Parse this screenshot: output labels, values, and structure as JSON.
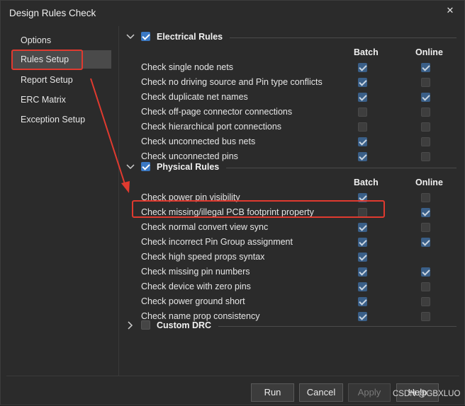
{
  "window": {
    "title": "Design Rules Check",
    "close_glyph": "✕"
  },
  "sidebar": {
    "items": [
      {
        "label": "Options",
        "active": false
      },
      {
        "label": "Rules Setup",
        "active": true
      },
      {
        "label": "Report Setup",
        "active": false
      },
      {
        "label": "ERC Matrix",
        "active": false
      },
      {
        "label": "Exception Setup",
        "active": false
      }
    ]
  },
  "columns": {
    "batch": "Batch",
    "online": "Online"
  },
  "sections": [
    {
      "title": "Electrical Rules",
      "expanded": true,
      "checked": true,
      "rules": [
        {
          "label": "Check single node nets",
          "batch": true,
          "online": true
        },
        {
          "label": "Check no driving source and Pin type conflicts",
          "batch": true,
          "online": false
        },
        {
          "label": "Check duplicate net names",
          "batch": true,
          "online": true
        },
        {
          "label": "Check off-page connector connections",
          "batch": false,
          "online": false
        },
        {
          "label": "Check hierarchical port connections",
          "batch": false,
          "online": false
        },
        {
          "label": "Check unconnected bus nets",
          "batch": true,
          "online": false
        },
        {
          "label": "Check unconnected pins",
          "batch": true,
          "online": false
        }
      ]
    },
    {
      "title": "Physical Rules",
      "expanded": true,
      "checked": true,
      "rules": [
        {
          "label": "Check power pin visibility",
          "batch": true,
          "online": false
        },
        {
          "label": "Check missing/illegal PCB footprint property",
          "batch": false,
          "online": true
        },
        {
          "label": "Check normal convert view sync",
          "batch": true,
          "online": false
        },
        {
          "label": "Check incorrect Pin Group assignment",
          "batch": true,
          "online": true
        },
        {
          "label": "Check high speed props syntax",
          "batch": true,
          "online": null
        },
        {
          "label": "Check missing pin numbers",
          "batch": true,
          "online": true
        },
        {
          "label": "Check device with zero pins",
          "batch": true,
          "online": false
        },
        {
          "label": "Check power ground short",
          "batch": true,
          "online": false
        },
        {
          "label": "Check name prop consistency",
          "batch": true,
          "online": false
        }
      ]
    },
    {
      "title": "Custom DRC",
      "expanded": false,
      "checked": false,
      "rules": []
    }
  ],
  "footer": {
    "buttons": [
      {
        "label": "Run",
        "enabled": true
      },
      {
        "label": "Cancel",
        "enabled": true
      },
      {
        "label": "Apply",
        "enabled": false
      },
      {
        "label": "Help",
        "enabled": true
      }
    ]
  },
  "watermark": "CSDN @GBXLUO",
  "annotation_color": "#e03a2f",
  "accent_color": "#3b79c4"
}
